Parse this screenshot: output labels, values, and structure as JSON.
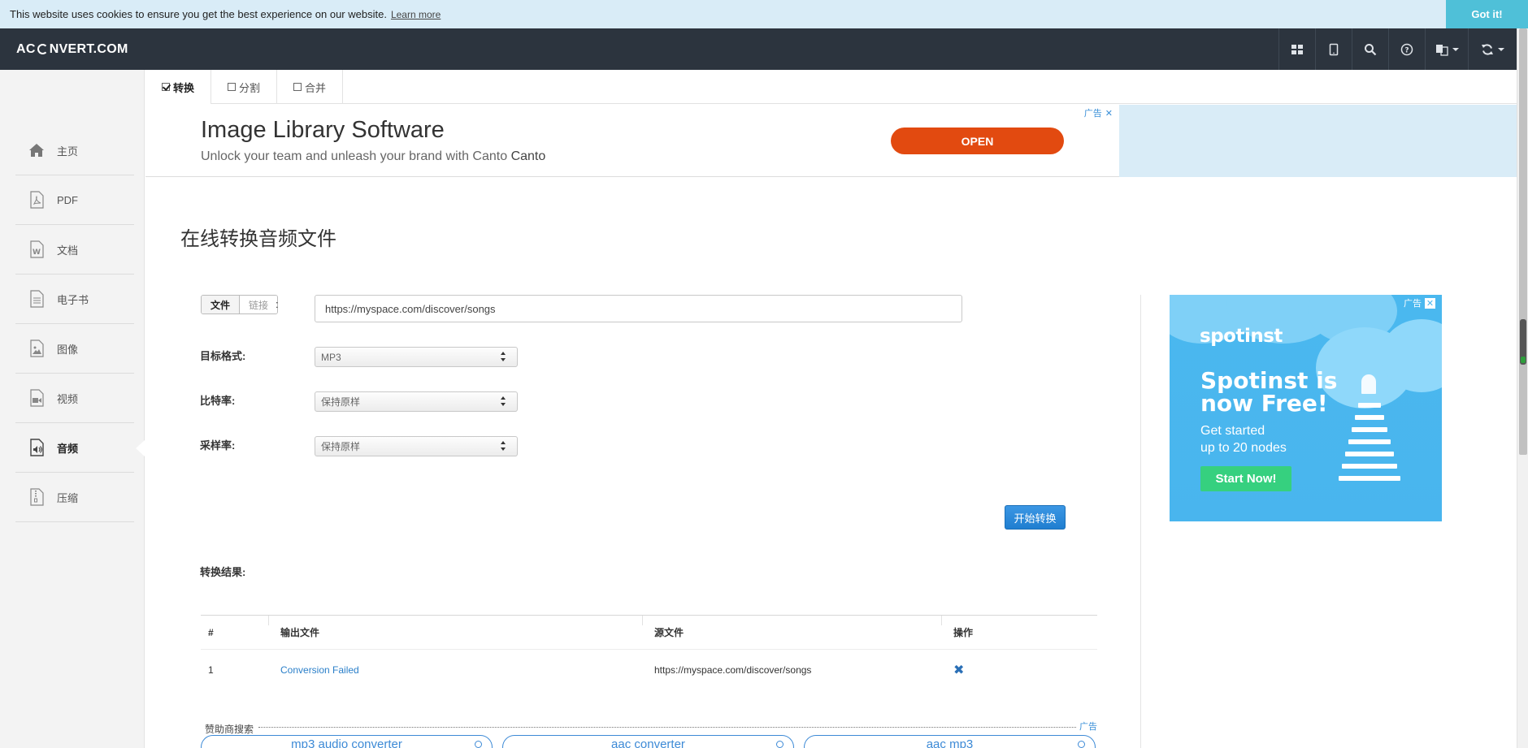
{
  "cookie": {
    "message": "This website uses cookies to ensure you get the best experience on our website.",
    "learn_more": "Learn more",
    "accept": "Got it!"
  },
  "navbar": {
    "logo_left": "AC",
    "logo_right": "NVERT.COM",
    "icons": [
      "grid-icon",
      "tablet-icon",
      "search-icon",
      "help-icon",
      "language-icon",
      "refresh-icon"
    ]
  },
  "sidebar": {
    "items": [
      {
        "label": "主页",
        "icon": "home-icon"
      },
      {
        "label": "PDF",
        "icon": "pdf-icon"
      },
      {
        "label": "文档",
        "icon": "document-icon"
      },
      {
        "label": "电子书",
        "icon": "ebook-icon"
      },
      {
        "label": "图像",
        "icon": "image-icon"
      },
      {
        "label": "视频",
        "icon": "video-icon"
      },
      {
        "label": "音频",
        "icon": "audio-icon",
        "active": true
      },
      {
        "label": "压缩",
        "icon": "archive-icon"
      }
    ]
  },
  "tabs": [
    {
      "label": "转换",
      "active": true
    },
    {
      "label": "分割",
      "active": false
    },
    {
      "label": "合并",
      "active": false
    }
  ],
  "ad_banner": {
    "title": "Image Library Software",
    "subtitle": "Unlock your team and unleash your brand with Canto",
    "brand": "Canto",
    "cta": "OPEN",
    "tag": "广告"
  },
  "main": {
    "title": "在线转换音频文件",
    "source_toggle": {
      "file": "文件",
      "link": "链接"
    },
    "colon": ":",
    "url_value": "https://myspace.com/discover/songs",
    "target_format_label": "目标格式:",
    "target_format_value": "MP3",
    "bitrate_label": "比特率:",
    "bitrate_value": "保持原样",
    "samplerate_label": "采样率:",
    "samplerate_value": "保持原样",
    "start_button": "开始转换",
    "results_label": "转换结果:"
  },
  "results_table": {
    "headers": [
      "#",
      "输出文件",
      "源文件",
      "操作"
    ],
    "rows": [
      {
        "index": "1",
        "output": "Conversion Failed",
        "source": "https://myspace.com/discover/songs",
        "action": "✖"
      }
    ]
  },
  "sponsor": {
    "label": "赞助商搜索",
    "ad_tag": "广告",
    "pills": [
      "mp3 audio converter",
      "aac converter",
      "aac mp3"
    ]
  },
  "right_ad": {
    "logo": "spotinst",
    "headline_1": "Spotinst is",
    "headline_2": "now Free!",
    "text_1": "Get started",
    "text_2": "up to 20 nodes",
    "cta": "Start Now!",
    "tag": "广告"
  },
  "colors": {
    "navbar": "#2c343e",
    "accent_blue": "#1f7ed0",
    "ad_orange": "#e24a10",
    "spotinst_blue": "#49b5ee",
    "spotinst_green": "#36d07f"
  }
}
